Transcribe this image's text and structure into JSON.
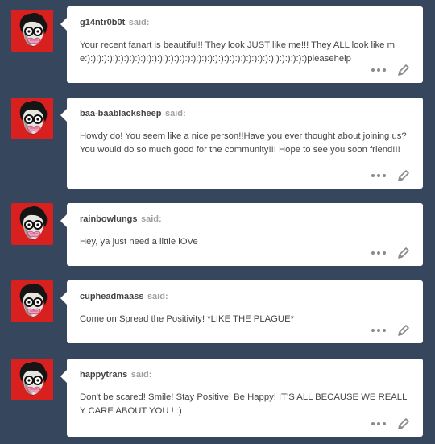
{
  "said_label": "said:",
  "icons": {
    "avatar": "avatar-face-icon",
    "more": "more-dots-icon",
    "edit": "pencil-icon"
  },
  "colors": {
    "background": "#36465d",
    "avatar_bg": "#d8201e",
    "card_bg": "#ffffff"
  },
  "asks": [
    {
      "asker": "g14ntr0b0t",
      "message": "Your recent fanart is beautiful!! They look JUST like me!!! They ALL look like me:):):):):):):):):):):):):):):):):):):):):):):):):):):):):):):):):):):):):):):):)pleasehelp"
    },
    {
      "asker": "baa-baablacksheep",
      "message": "Howdy do! You seem like a nice person!!Have you ever thought about joining us? You would do so much good for the community!!! Hope to see you soon friend!!!"
    },
    {
      "asker": "rainbowlungs",
      "message": "Hey, ya just need a little lOVe"
    },
    {
      "asker": "cupheadmaass",
      "message": "Come on Spread the Positivity! *LIKE THE PLAGUE*"
    },
    {
      "asker": "happytrans",
      "message": "Don't be scared! Smile! Stay Positive! Be Happy! IT'S ALL BECAUSE WE REALLY CARE ABOUT YOU ! :)"
    }
  ]
}
